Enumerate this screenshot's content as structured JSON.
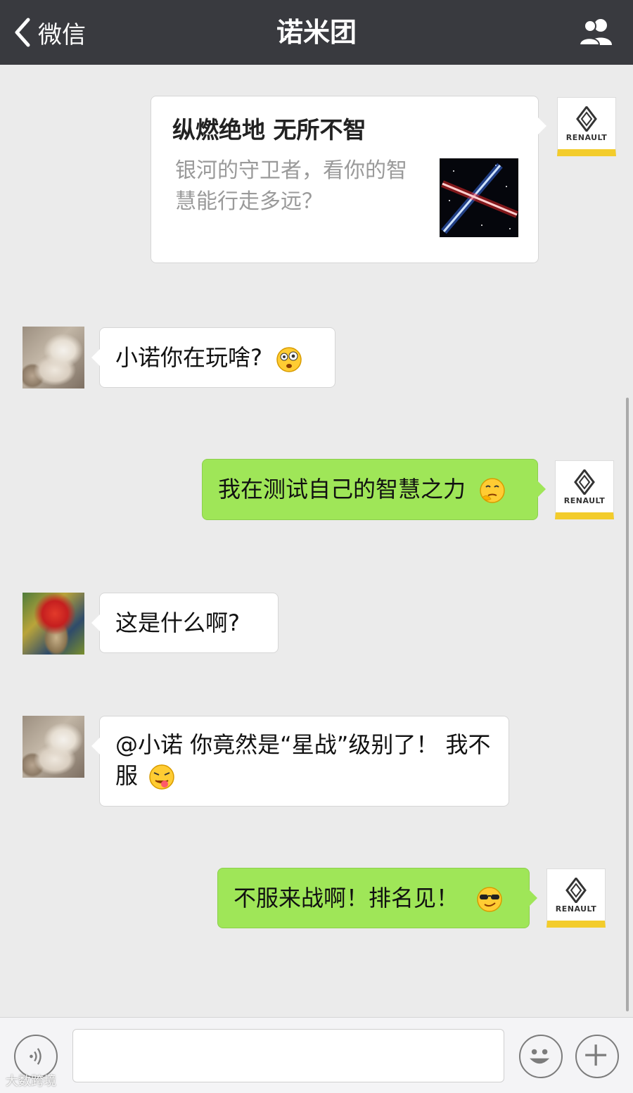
{
  "header": {
    "back_label": "微信",
    "title": "诺米团"
  },
  "messages": [
    {
      "type": "link-card",
      "side": "right",
      "sender": "Renault",
      "card_title": "纵燃绝地 无所不智",
      "card_desc": "银河的守卫者，看你的智慧能行走多远？"
    },
    {
      "type": "text",
      "side": "left",
      "avatar": "cat",
      "text": "小诺你在玩啥?",
      "emoji": "shocked-face-icon"
    },
    {
      "type": "text",
      "side": "right",
      "sender": "Renault",
      "text": "我在测试自己的智慧之力",
      "emoji": "thinking-face-icon"
    },
    {
      "type": "text",
      "side": "left",
      "avatar": "red-hair",
      "text": "这是什么啊?"
    },
    {
      "type": "text",
      "side": "left",
      "avatar": "cat",
      "text": "@小诺 你竟然是“星战”级别了！ 我不服",
      "emoji": "tongue-face-icon"
    },
    {
      "type": "text",
      "side": "right",
      "sender": "Renault",
      "text": "不服来战啊！排名见！",
      "emoji": "sunglasses-face-icon"
    }
  ],
  "renault_label": "RENAULT",
  "input": {
    "value": "",
    "placeholder": ""
  },
  "watermark": "大数跨境",
  "colors": {
    "topbar": "#393a3f",
    "background": "#ebebeb",
    "green_bubble": "#9fe658",
    "renault_yellow": "#f3cc2b"
  }
}
